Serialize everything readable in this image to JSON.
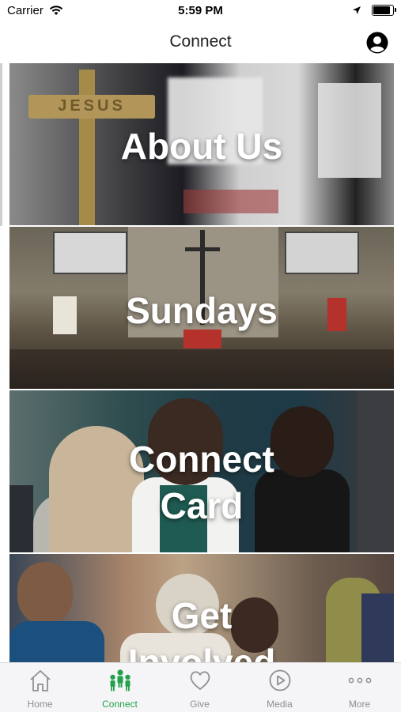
{
  "status_bar": {
    "carrier": "Carrier",
    "time": "5:59 PM"
  },
  "nav": {
    "title": "Connect"
  },
  "tiles": [
    {
      "label": "About Us"
    },
    {
      "label": "Sundays"
    },
    {
      "label_line1": "Connect",
      "label_line2": "Card"
    },
    {
      "label_line1": "Get",
      "label_line2": "Involved"
    }
  ],
  "tab_bar": {
    "items": [
      {
        "label": "Home",
        "icon": "home-icon",
        "active": false
      },
      {
        "label": "Connect",
        "icon": "people-icon",
        "active": true
      },
      {
        "label": "Give",
        "icon": "heart-icon",
        "active": false
      },
      {
        "label": "Media",
        "icon": "play-icon",
        "active": false
      },
      {
        "label": "More",
        "icon": "ellipsis-icon",
        "active": false
      }
    ],
    "active_color": "#22a24a",
    "inactive_color": "#8e8e93"
  }
}
